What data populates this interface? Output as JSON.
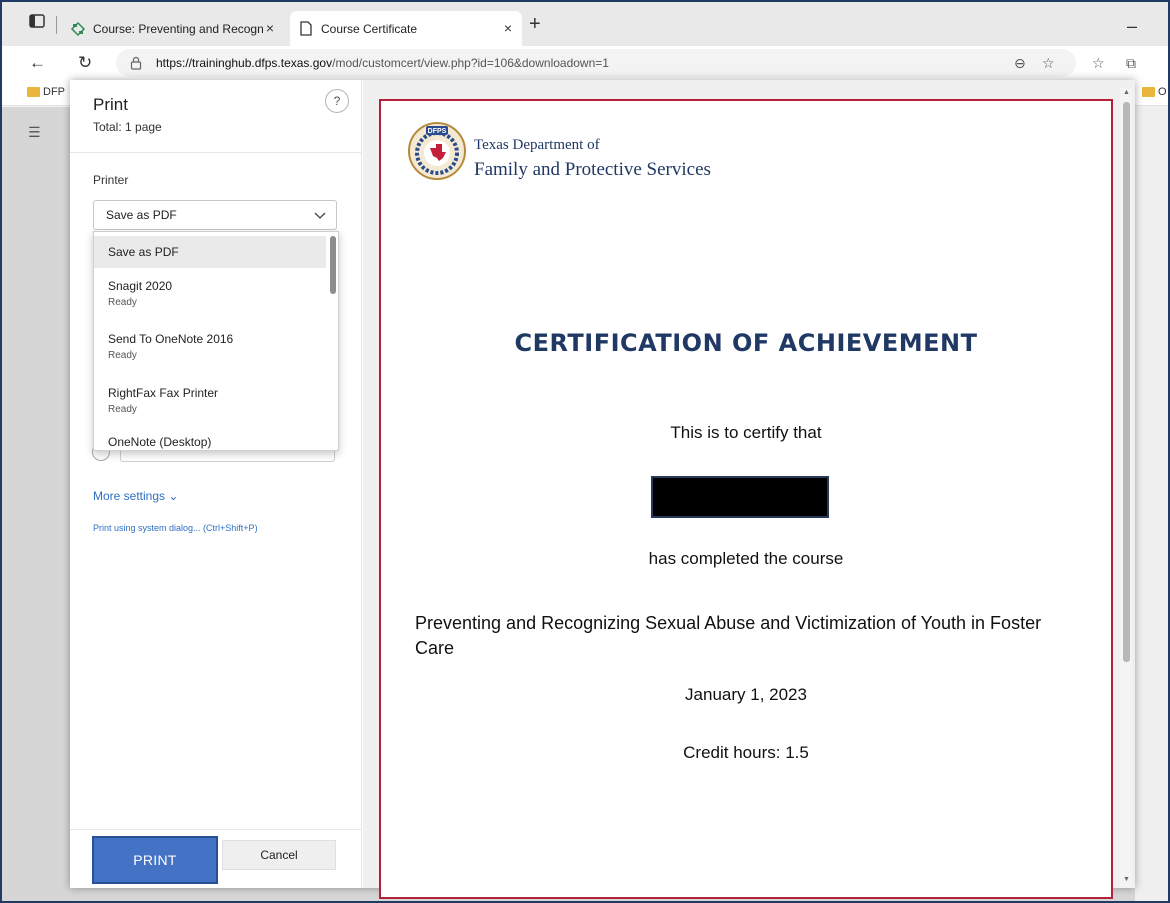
{
  "browser": {
    "tabs": [
      {
        "label": "Course: Preventing and Recogniz",
        "active": false
      },
      {
        "label": "Course Certificate",
        "active": true
      }
    ],
    "new_tab_symbol": "+",
    "tab_close_symbol": "×",
    "minimize_symbol": "–",
    "url_host": "https://traininghub.dfps.texas.gov",
    "url_path": "/mod/customcert/view.php?id=106&downloadown=1",
    "bookmarks": {
      "left": "DFP",
      "right": "O"
    }
  },
  "print_panel": {
    "title": "Print",
    "total": "Total: 1 page",
    "help_symbol": "?",
    "printer_label": "Printer",
    "selected_printer": "Save as PDF",
    "printer_options": [
      {
        "name": "Save as PDF",
        "status": ""
      },
      {
        "name": "Snagit 2020",
        "status": "Ready"
      },
      {
        "name": "Send To OneNote 2016",
        "status": "Ready"
      },
      {
        "name": "RightFax Fax Printer",
        "status": "Ready"
      },
      {
        "name": "OneNote (Desktop)",
        "status": ""
      }
    ],
    "more_settings": "More settings ⌄",
    "system_dialog": "Print using system dialog... (Ctrl+Shift+P)",
    "print_button": "PRINT",
    "cancel_button": "Cancel"
  },
  "certificate": {
    "logo_text": "DFPS",
    "org_line1": "Texas Department of",
    "org_line2": "Family and Protective Services",
    "title": "CERTIFICATION OF ACHIEVEMENT",
    "certify_line": "This is to certify that",
    "completed_line": "has completed the course",
    "course_name": "Preventing and Recognizing Sexual Abuse and Victimization of Youth in Foster Care",
    "date": "January 1, 2023",
    "credit_hours": "Credit hours: 1.5"
  },
  "colors": {
    "accent_blue": "#4472c4",
    "link_blue": "#2f6fc6",
    "navy": "#1f3864",
    "paper_border": "#b3213a"
  }
}
